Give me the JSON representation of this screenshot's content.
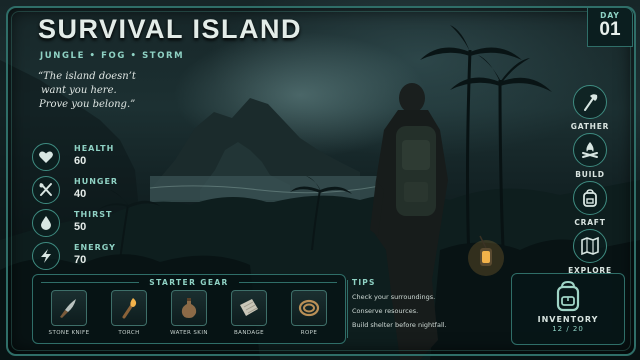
{
  "game": {
    "title": "SURVIVAL ISLAND",
    "subtitle": "JUNGLE • FOG • STORM",
    "quote_lines": [
      "“The island doesn’t",
      "want you here.",
      "Prove you belong.”"
    ]
  },
  "day": {
    "label": "DAY",
    "number": "01"
  },
  "stats": [
    {
      "name": "HEALTH",
      "value": "60",
      "icon": "heart-icon"
    },
    {
      "name": "HUNGER",
      "value": "40",
      "icon": "utensils-icon"
    },
    {
      "name": "THIRST",
      "value": "50",
      "icon": "water-drop-icon"
    },
    {
      "name": "ENERGY",
      "value": "70",
      "icon": "lightning-icon"
    }
  ],
  "actions": [
    {
      "label": "GATHER",
      "icon": "axe-icon"
    },
    {
      "label": "BUILD",
      "icon": "campfire-icon"
    },
    {
      "label": "CRAFT",
      "icon": "backpack-icon"
    },
    {
      "label": "EXPLORE",
      "icon": "map-icon"
    }
  ],
  "starter_gear": {
    "heading": "STARTER GEAR",
    "items": [
      {
        "label": "STONE KNIFE",
        "icon": "knife-icon"
      },
      {
        "label": "TORCH",
        "icon": "torch-icon"
      },
      {
        "label": "WATER SKIN",
        "icon": "water-skin-icon"
      },
      {
        "label": "BANDAGE",
        "icon": "bandage-icon"
      },
      {
        "label": "ROPE",
        "icon": "rope-icon"
      }
    ]
  },
  "tips": {
    "heading": "TIPS",
    "items": [
      "Check your surroundings.",
      "Conserve resources.",
      "Build shelter before nightfall."
    ]
  },
  "inventory": {
    "label": "INVENTORY",
    "count": "12 / 20",
    "icon": "backpack-icon"
  },
  "colors": {
    "accent": "#8fd2c4",
    "frame": "#2f6e68",
    "lantern": "#f2b24a"
  }
}
